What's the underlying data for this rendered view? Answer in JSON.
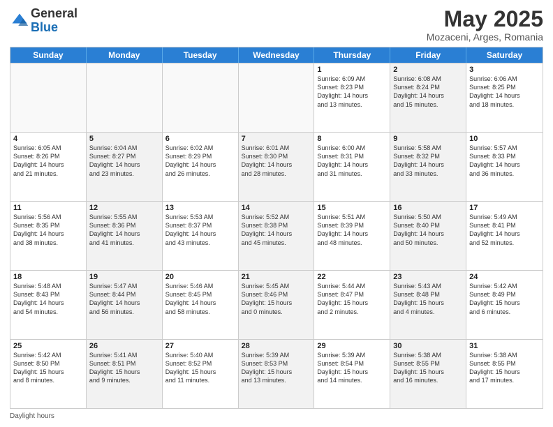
{
  "header": {
    "logo_general": "General",
    "logo_blue": "Blue",
    "month_title": "May 2025",
    "subtitle": "Mozaceni, Arges, Romania"
  },
  "days_of_week": [
    "Sunday",
    "Monday",
    "Tuesday",
    "Wednesday",
    "Thursday",
    "Friday",
    "Saturday"
  ],
  "weeks": [
    [
      {
        "day": "",
        "info": "",
        "empty": true
      },
      {
        "day": "",
        "info": "",
        "empty": true
      },
      {
        "day": "",
        "info": "",
        "empty": true
      },
      {
        "day": "",
        "info": "",
        "empty": true
      },
      {
        "day": "1",
        "info": "Sunrise: 6:09 AM\nSunset: 8:23 PM\nDaylight: 14 hours\nand 13 minutes.",
        "shaded": false
      },
      {
        "day": "2",
        "info": "Sunrise: 6:08 AM\nSunset: 8:24 PM\nDaylight: 14 hours\nand 15 minutes.",
        "shaded": true
      },
      {
        "day": "3",
        "info": "Sunrise: 6:06 AM\nSunset: 8:25 PM\nDaylight: 14 hours\nand 18 minutes.",
        "shaded": false
      }
    ],
    [
      {
        "day": "4",
        "info": "Sunrise: 6:05 AM\nSunset: 8:26 PM\nDaylight: 14 hours\nand 21 minutes.",
        "shaded": false
      },
      {
        "day": "5",
        "info": "Sunrise: 6:04 AM\nSunset: 8:27 PM\nDaylight: 14 hours\nand 23 minutes.",
        "shaded": true
      },
      {
        "day": "6",
        "info": "Sunrise: 6:02 AM\nSunset: 8:29 PM\nDaylight: 14 hours\nand 26 minutes.",
        "shaded": false
      },
      {
        "day": "7",
        "info": "Sunrise: 6:01 AM\nSunset: 8:30 PM\nDaylight: 14 hours\nand 28 minutes.",
        "shaded": true
      },
      {
        "day": "8",
        "info": "Sunrise: 6:00 AM\nSunset: 8:31 PM\nDaylight: 14 hours\nand 31 minutes.",
        "shaded": false
      },
      {
        "day": "9",
        "info": "Sunrise: 5:58 AM\nSunset: 8:32 PM\nDaylight: 14 hours\nand 33 minutes.",
        "shaded": true
      },
      {
        "day": "10",
        "info": "Sunrise: 5:57 AM\nSunset: 8:33 PM\nDaylight: 14 hours\nand 36 minutes.",
        "shaded": false
      }
    ],
    [
      {
        "day": "11",
        "info": "Sunrise: 5:56 AM\nSunset: 8:35 PM\nDaylight: 14 hours\nand 38 minutes.",
        "shaded": false
      },
      {
        "day": "12",
        "info": "Sunrise: 5:55 AM\nSunset: 8:36 PM\nDaylight: 14 hours\nand 41 minutes.",
        "shaded": true
      },
      {
        "day": "13",
        "info": "Sunrise: 5:53 AM\nSunset: 8:37 PM\nDaylight: 14 hours\nand 43 minutes.",
        "shaded": false
      },
      {
        "day": "14",
        "info": "Sunrise: 5:52 AM\nSunset: 8:38 PM\nDaylight: 14 hours\nand 45 minutes.",
        "shaded": true
      },
      {
        "day": "15",
        "info": "Sunrise: 5:51 AM\nSunset: 8:39 PM\nDaylight: 14 hours\nand 48 minutes.",
        "shaded": false
      },
      {
        "day": "16",
        "info": "Sunrise: 5:50 AM\nSunset: 8:40 PM\nDaylight: 14 hours\nand 50 minutes.",
        "shaded": true
      },
      {
        "day": "17",
        "info": "Sunrise: 5:49 AM\nSunset: 8:41 PM\nDaylight: 14 hours\nand 52 minutes.",
        "shaded": false
      }
    ],
    [
      {
        "day": "18",
        "info": "Sunrise: 5:48 AM\nSunset: 8:43 PM\nDaylight: 14 hours\nand 54 minutes.",
        "shaded": false
      },
      {
        "day": "19",
        "info": "Sunrise: 5:47 AM\nSunset: 8:44 PM\nDaylight: 14 hours\nand 56 minutes.",
        "shaded": true
      },
      {
        "day": "20",
        "info": "Sunrise: 5:46 AM\nSunset: 8:45 PM\nDaylight: 14 hours\nand 58 minutes.",
        "shaded": false
      },
      {
        "day": "21",
        "info": "Sunrise: 5:45 AM\nSunset: 8:46 PM\nDaylight: 15 hours\nand 0 minutes.",
        "shaded": true
      },
      {
        "day": "22",
        "info": "Sunrise: 5:44 AM\nSunset: 8:47 PM\nDaylight: 15 hours\nand 2 minutes.",
        "shaded": false
      },
      {
        "day": "23",
        "info": "Sunrise: 5:43 AM\nSunset: 8:48 PM\nDaylight: 15 hours\nand 4 minutes.",
        "shaded": true
      },
      {
        "day": "24",
        "info": "Sunrise: 5:42 AM\nSunset: 8:49 PM\nDaylight: 15 hours\nand 6 minutes.",
        "shaded": false
      }
    ],
    [
      {
        "day": "25",
        "info": "Sunrise: 5:42 AM\nSunset: 8:50 PM\nDaylight: 15 hours\nand 8 minutes.",
        "shaded": false
      },
      {
        "day": "26",
        "info": "Sunrise: 5:41 AM\nSunset: 8:51 PM\nDaylight: 15 hours\nand 9 minutes.",
        "shaded": true
      },
      {
        "day": "27",
        "info": "Sunrise: 5:40 AM\nSunset: 8:52 PM\nDaylight: 15 hours\nand 11 minutes.",
        "shaded": false
      },
      {
        "day": "28",
        "info": "Sunrise: 5:39 AM\nSunset: 8:53 PM\nDaylight: 15 hours\nand 13 minutes.",
        "shaded": true
      },
      {
        "day": "29",
        "info": "Sunrise: 5:39 AM\nSunset: 8:54 PM\nDaylight: 15 hours\nand 14 minutes.",
        "shaded": false
      },
      {
        "day": "30",
        "info": "Sunrise: 5:38 AM\nSunset: 8:55 PM\nDaylight: 15 hours\nand 16 minutes.",
        "shaded": true
      },
      {
        "day": "31",
        "info": "Sunrise: 5:38 AM\nSunset: 8:55 PM\nDaylight: 15 hours\nand 17 minutes.",
        "shaded": false
      }
    ]
  ],
  "footer": {
    "daylight_label": "Daylight hours"
  }
}
